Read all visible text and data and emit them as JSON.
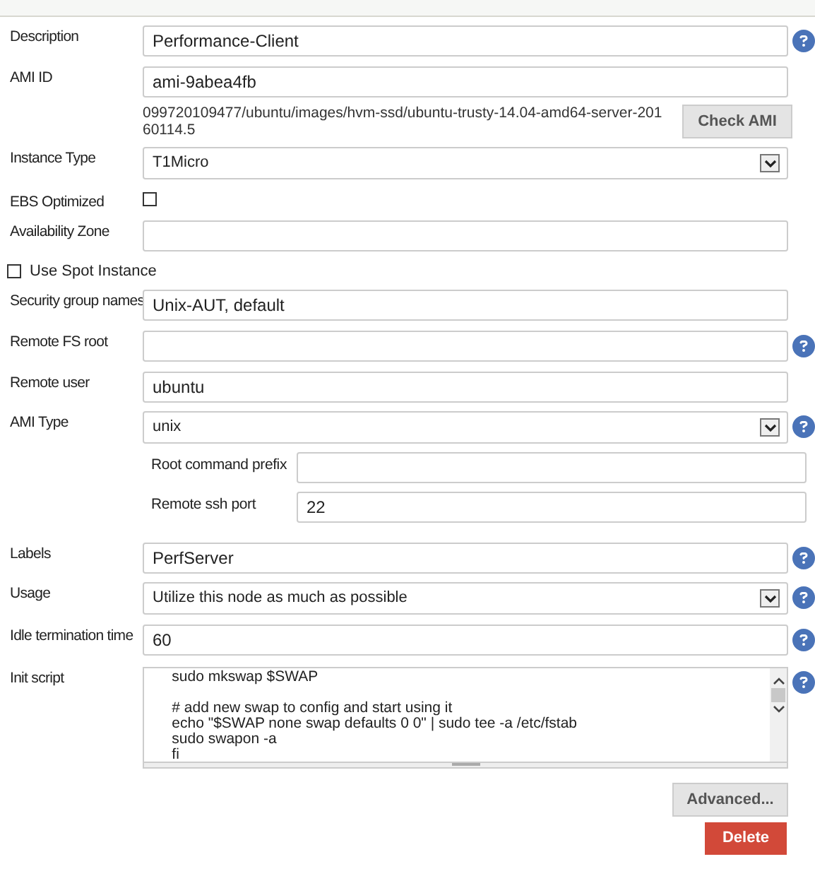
{
  "fields": [
    {
      "kind": "text",
      "label": "Description",
      "value": "Performance-Client",
      "help": true
    },
    {
      "kind": "text",
      "label": "AMI ID",
      "value": "ami-9abea4fb",
      "help": false,
      "info": "099720109477/ubuntu/images/hvm-ssd/ubuntu-trusty-14.04-amd64-server-20160114.5",
      "button": "Check AMI"
    },
    {
      "kind": "select",
      "label": "Instance Type",
      "value": "T1Micro",
      "help": false
    },
    {
      "kind": "checkbox",
      "label": "EBS Optimized",
      "checked": false,
      "help": false
    },
    {
      "kind": "text",
      "label": "Availability Zone",
      "help": false
    },
    {
      "kind": "wide_checkbox",
      "label": "Use Spot Instance",
      "checked": false,
      "help": false
    },
    {
      "kind": "text",
      "label": "Security group names",
      "value": "Unix-AUT, default",
      "help": false
    },
    {
      "kind": "text",
      "label": "Remote FS root",
      "help": true
    },
    {
      "kind": "text",
      "label": "Remote user",
      "value": "ubuntu",
      "help": false
    },
    {
      "kind": "select",
      "label": "AMI Type",
      "value": "unix",
      "help": true,
      "subfields": [
        {
          "label": "Root command prefix"
        },
        {
          "label": "Remote ssh port",
          "value": "22"
        }
      ]
    },
    {
      "kind": "text",
      "label": "Labels",
      "value": "PerfServer",
      "help": true
    },
    {
      "kind": "select",
      "label": "Usage",
      "value": "Utilize this node as much as possible",
      "help": true
    },
    {
      "kind": "text",
      "label": "Idle termination time",
      "value": "60",
      "help": true
    },
    {
      "kind": "textarea",
      "label": "Init script",
      "value": "    sudo mkswap $SWAP\n\n    # add new swap to config and start using it\n    echo \"$SWAP none swap defaults 0 0\" | sudo tee -a /etc/fstab\n    sudo swapon -a\n    fi",
      "help": true
    }
  ],
  "buttons": [
    {
      "kind": "advanced",
      "label": "Advanced..."
    },
    {
      "kind": "delete",
      "label": "Delete"
    }
  ]
}
